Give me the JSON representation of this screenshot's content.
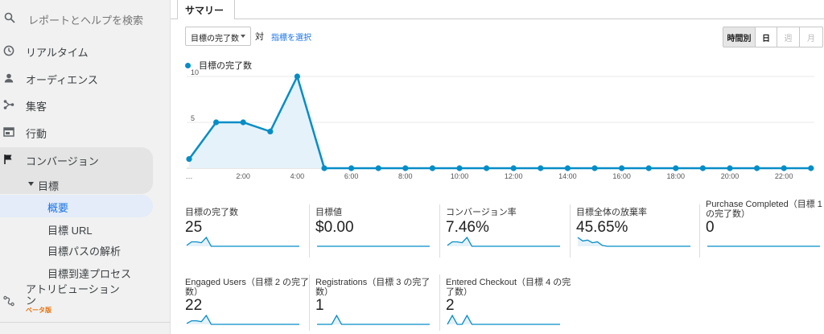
{
  "sidebar": {
    "search_placeholder": "レポートとヘルプを検索",
    "items": [
      {
        "label": "リアルタイム",
        "icon": "clock-icon"
      },
      {
        "label": "オーディエンス",
        "icon": "person-icon"
      },
      {
        "label": "集客",
        "icon": "acquisition-icon"
      },
      {
        "label": "行動",
        "icon": "behavior-icon"
      },
      {
        "label": "コンバージョン",
        "icon": "flag-icon"
      }
    ],
    "goals_label": "目標",
    "sub_items": [
      "概要",
      "目標 URL",
      "目標パスの解析",
      "目標到達プロセス"
    ],
    "attribution_label": "アトリビューション",
    "attribution_label_line2": "ン",
    "beta_label": "ベータ版"
  },
  "main": {
    "tab_label": "サマリー",
    "metric_select": "目標の完了数",
    "vs_label": "対",
    "select_metric_link": "指標を選択",
    "time_buttons": [
      "時間別",
      "日",
      "週",
      "月"
    ]
  },
  "chart_data": {
    "type": "area",
    "series": [
      {
        "name": "目標の完了数",
        "values": [
          1,
          5,
          5,
          4,
          10,
          0,
          0,
          0,
          0,
          0,
          0,
          0,
          0,
          0,
          0,
          0,
          0,
          0,
          0,
          0,
          0,
          0,
          0,
          0
        ]
      }
    ],
    "x": [
      "0:00",
      "1:00",
      "2:00",
      "3:00",
      "4:00",
      "5:00",
      "6:00",
      "7:00",
      "8:00",
      "9:00",
      "10:00",
      "11:00",
      "12:00",
      "13:00",
      "14:00",
      "15:00",
      "16:00",
      "17:00",
      "18:00",
      "19:00",
      "20:00",
      "21:00",
      "22:00",
      "23:00"
    ],
    "x_tick_labels": [
      "…",
      "2:00",
      "4:00",
      "6:00",
      "8:00",
      "10:00",
      "12:00",
      "14:00",
      "16:00",
      "18:00",
      "20:00",
      "22:00"
    ],
    "y_ticks": [
      "5",
      "10"
    ],
    "ylim": [
      0,
      10
    ],
    "color": "#058dc7",
    "fill_color": "#e6f2f9"
  },
  "metrics": [
    {
      "label": "目標の完了数",
      "value": "25",
      "spark": [
        1,
        5,
        5,
        4,
        10,
        0,
        0,
        0,
        0,
        0,
        0,
        0,
        0,
        0,
        0,
        0,
        0,
        0,
        0,
        0,
        0,
        0,
        0,
        0
      ]
    },
    {
      "label": "目標値",
      "value": "$0.00",
      "spark": [
        0,
        0,
        0,
        0,
        0,
        0,
        0,
        0,
        0,
        0,
        0,
        0,
        0,
        0,
        0,
        0,
        0,
        0,
        0,
        0,
        0,
        0,
        0,
        0
      ]
    },
    {
      "label": "コンバージョン率",
      "value": "7.46%",
      "spark": [
        1,
        5,
        5,
        4,
        10,
        0,
        0,
        0,
        0,
        0,
        0,
        0,
        0,
        0,
        0,
        0,
        0,
        0,
        0,
        0,
        0,
        0,
        0,
        0
      ]
    },
    {
      "label": "目標全体の放棄率",
      "value": "45.65%",
      "spark": [
        10,
        6,
        7,
        4,
        5,
        1,
        0,
        0,
        0,
        0,
        0,
        0,
        0,
        0,
        0,
        0,
        0,
        0,
        0,
        0,
        0,
        0,
        0,
        0
      ]
    },
    {
      "label": "Purchase Completed（目標 1 の完了数）",
      "value": "0",
      "spark": [
        0,
        0,
        0,
        0,
        0,
        0,
        0,
        0,
        0,
        0,
        0,
        0,
        0,
        0,
        0,
        0,
        0,
        0,
        0,
        0,
        0,
        0,
        0,
        0
      ]
    },
    {
      "label": "Engaged Users（目標 2 の完了数）",
      "value": "22",
      "spark": [
        1,
        4,
        4,
        3,
        10,
        0,
        0,
        0,
        0,
        0,
        0,
        0,
        0,
        0,
        0,
        0,
        0,
        0,
        0,
        0,
        0,
        0,
        0,
        0
      ]
    },
    {
      "label": "Registrations（目標 3 の完了数）",
      "value": "1",
      "spark": [
        0,
        0,
        0,
        0,
        10,
        0,
        0,
        0,
        0,
        0,
        0,
        0,
        0,
        0,
        0,
        0,
        0,
        0,
        0,
        0,
        0,
        0,
        0,
        0
      ]
    },
    {
      "label": "Entered Checkout（目標 4 の完了数）",
      "value": "2",
      "spark": [
        0,
        10,
        0,
        0,
        10,
        0,
        0,
        0,
        0,
        0,
        0,
        0,
        0,
        0,
        0,
        0,
        0,
        0,
        0,
        0,
        0,
        0,
        0,
        0
      ]
    }
  ]
}
